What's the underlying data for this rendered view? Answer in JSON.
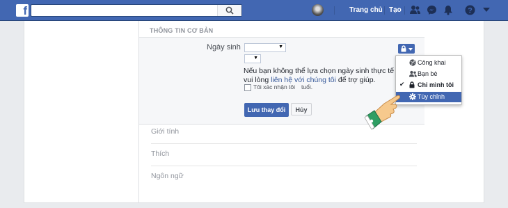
{
  "topbar": {
    "logo_letter": "f",
    "search_placeholder": "",
    "nav": {
      "home": "Trang chủ",
      "create": "Tạo"
    }
  },
  "section": {
    "title": "THÔNG TIN CƠ BẢN",
    "birthday_label": "Ngày sinh",
    "help_line1": "Nếu bạn không thể lựa chọn ngày sinh thực tế của b",
    "help_line2_prefix": "vui lòng ",
    "help_link": "liên hệ với chúng tôi",
    "help_line2_suffix": " để trợ giúp.",
    "confirm_label": "Tôi xác nhận tôi",
    "confirm_suffix": "tuổi.",
    "save_button": "Lưu thay đổi",
    "cancel_button": "Hủy",
    "fields": [
      "Giới tính",
      "Thích",
      "Ngôn ngữ"
    ]
  },
  "privacy_menu": {
    "items": [
      {
        "label": "Công khai",
        "icon": "globe-icon",
        "selected": false,
        "highlighted": false
      },
      {
        "label": "Bạn bè",
        "icon": "friends-icon",
        "selected": false,
        "highlighted": false
      },
      {
        "label": "Chỉ mình tôi",
        "icon": "lock-icon",
        "selected": true,
        "highlighted": false
      },
      {
        "label": "Tùy chỉnh",
        "icon": "gear-icon",
        "selected": false,
        "highlighted": true
      }
    ]
  },
  "colors": {
    "brand": "#4267b2",
    "link": "#365899"
  }
}
